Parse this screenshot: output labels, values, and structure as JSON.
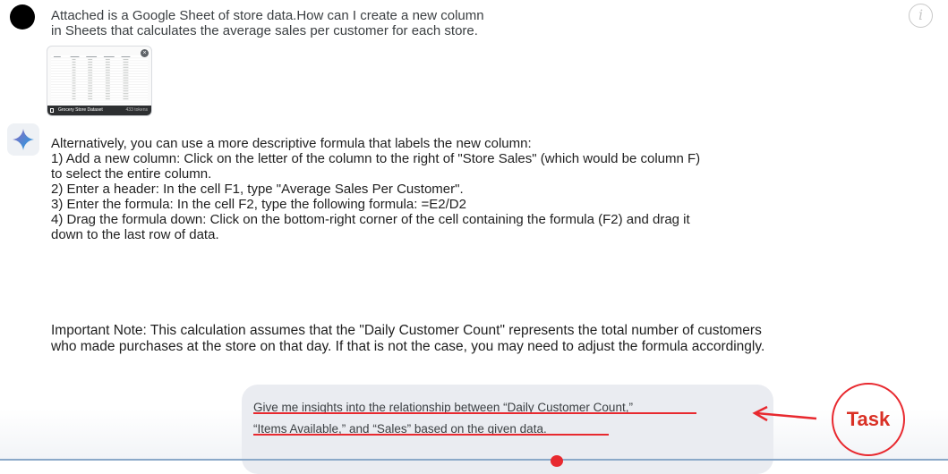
{
  "user_message": {
    "lines": [
      "Attached is a Google Sheet of store data.How can I create a new column",
      "in Sheets that calculates the average sales per customer for each store."
    ]
  },
  "attachment": {
    "file_name": "Grocery Store Dataset",
    "token_count": "433 tokens"
  },
  "response": {
    "lines": [
      "Alternatively, you can use a more descriptive formula that labels the new column:",
      "1) Add a new column: Click on the letter of the column to the right of \"Store Sales\" (which would be column F)",
      "to select the entire column.",
      "2) Enter a header: In the cell F1, type \"Average Sales Per Customer\".",
      "3) Enter the formula: In the cell F2, type the following formula: =E2/D2",
      "4) Drag the formula down: Click on the bottom-right corner of the cell containing the formula (F2) and drag it",
      "down to the last row of data."
    ],
    "note_lines": [
      "Important Note: This calculation assumes that the \"Daily Customer Count\" represents the total number of customers",
      "who made purchases at the store on that day. If that is not the case, you may need to adjust the formula accordingly."
    ]
  },
  "prompt": {
    "lines": [
      "Give me insights into the relationship between “Daily Customer Count,”",
      "“Items Available,” and “Sales” based on the given data."
    ]
  },
  "annotation": {
    "label": "Task",
    "color": "#e8292f"
  },
  "icons": {
    "user": "user-avatar",
    "assistant": "gemini-sparkle-icon",
    "info": "info-icon",
    "close": "close-icon",
    "document": "document-icon"
  }
}
